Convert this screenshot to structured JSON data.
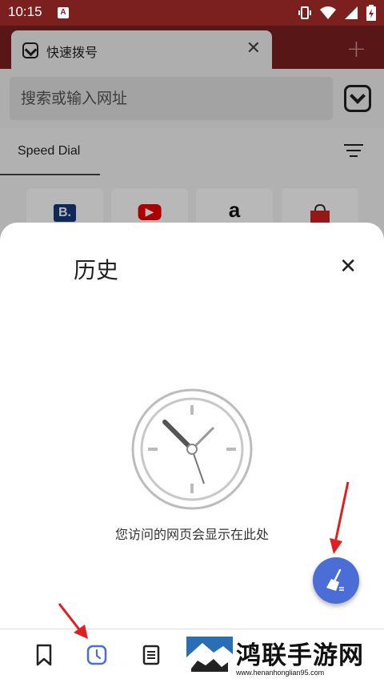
{
  "status_bar": {
    "time": "10:15",
    "a_badge": "A"
  },
  "tab": {
    "title": "快速拨号",
    "close_glyph": "✕",
    "new_tab_glyph": "+"
  },
  "address_bar": {
    "placeholder": "搜索或输入网址"
  },
  "speed_dial": {
    "tab_label": "Speed Dial"
  },
  "tiles": [
    {
      "name": "booking",
      "glyph": "B."
    },
    {
      "name": "youtube",
      "glyph": "▶"
    },
    {
      "name": "amazon",
      "glyph": "a"
    },
    {
      "name": "shopping",
      "glyph": ""
    }
  ],
  "history_panel": {
    "title": "历史",
    "close_glyph": "✕",
    "empty_message": "您访问的网页会显示在此处"
  },
  "bottom_nav": {
    "items": [
      "bookmarks-icon",
      "history-icon",
      "notes-icon"
    ]
  },
  "watermark": {
    "text": "鸿联手游网",
    "url": "www.henanhonglian95.com"
  },
  "colors": {
    "brand": "#7b1f1f",
    "fab": "#4a6dd6",
    "arrow": "#e02020",
    "history_active": "#4a6dd6"
  }
}
